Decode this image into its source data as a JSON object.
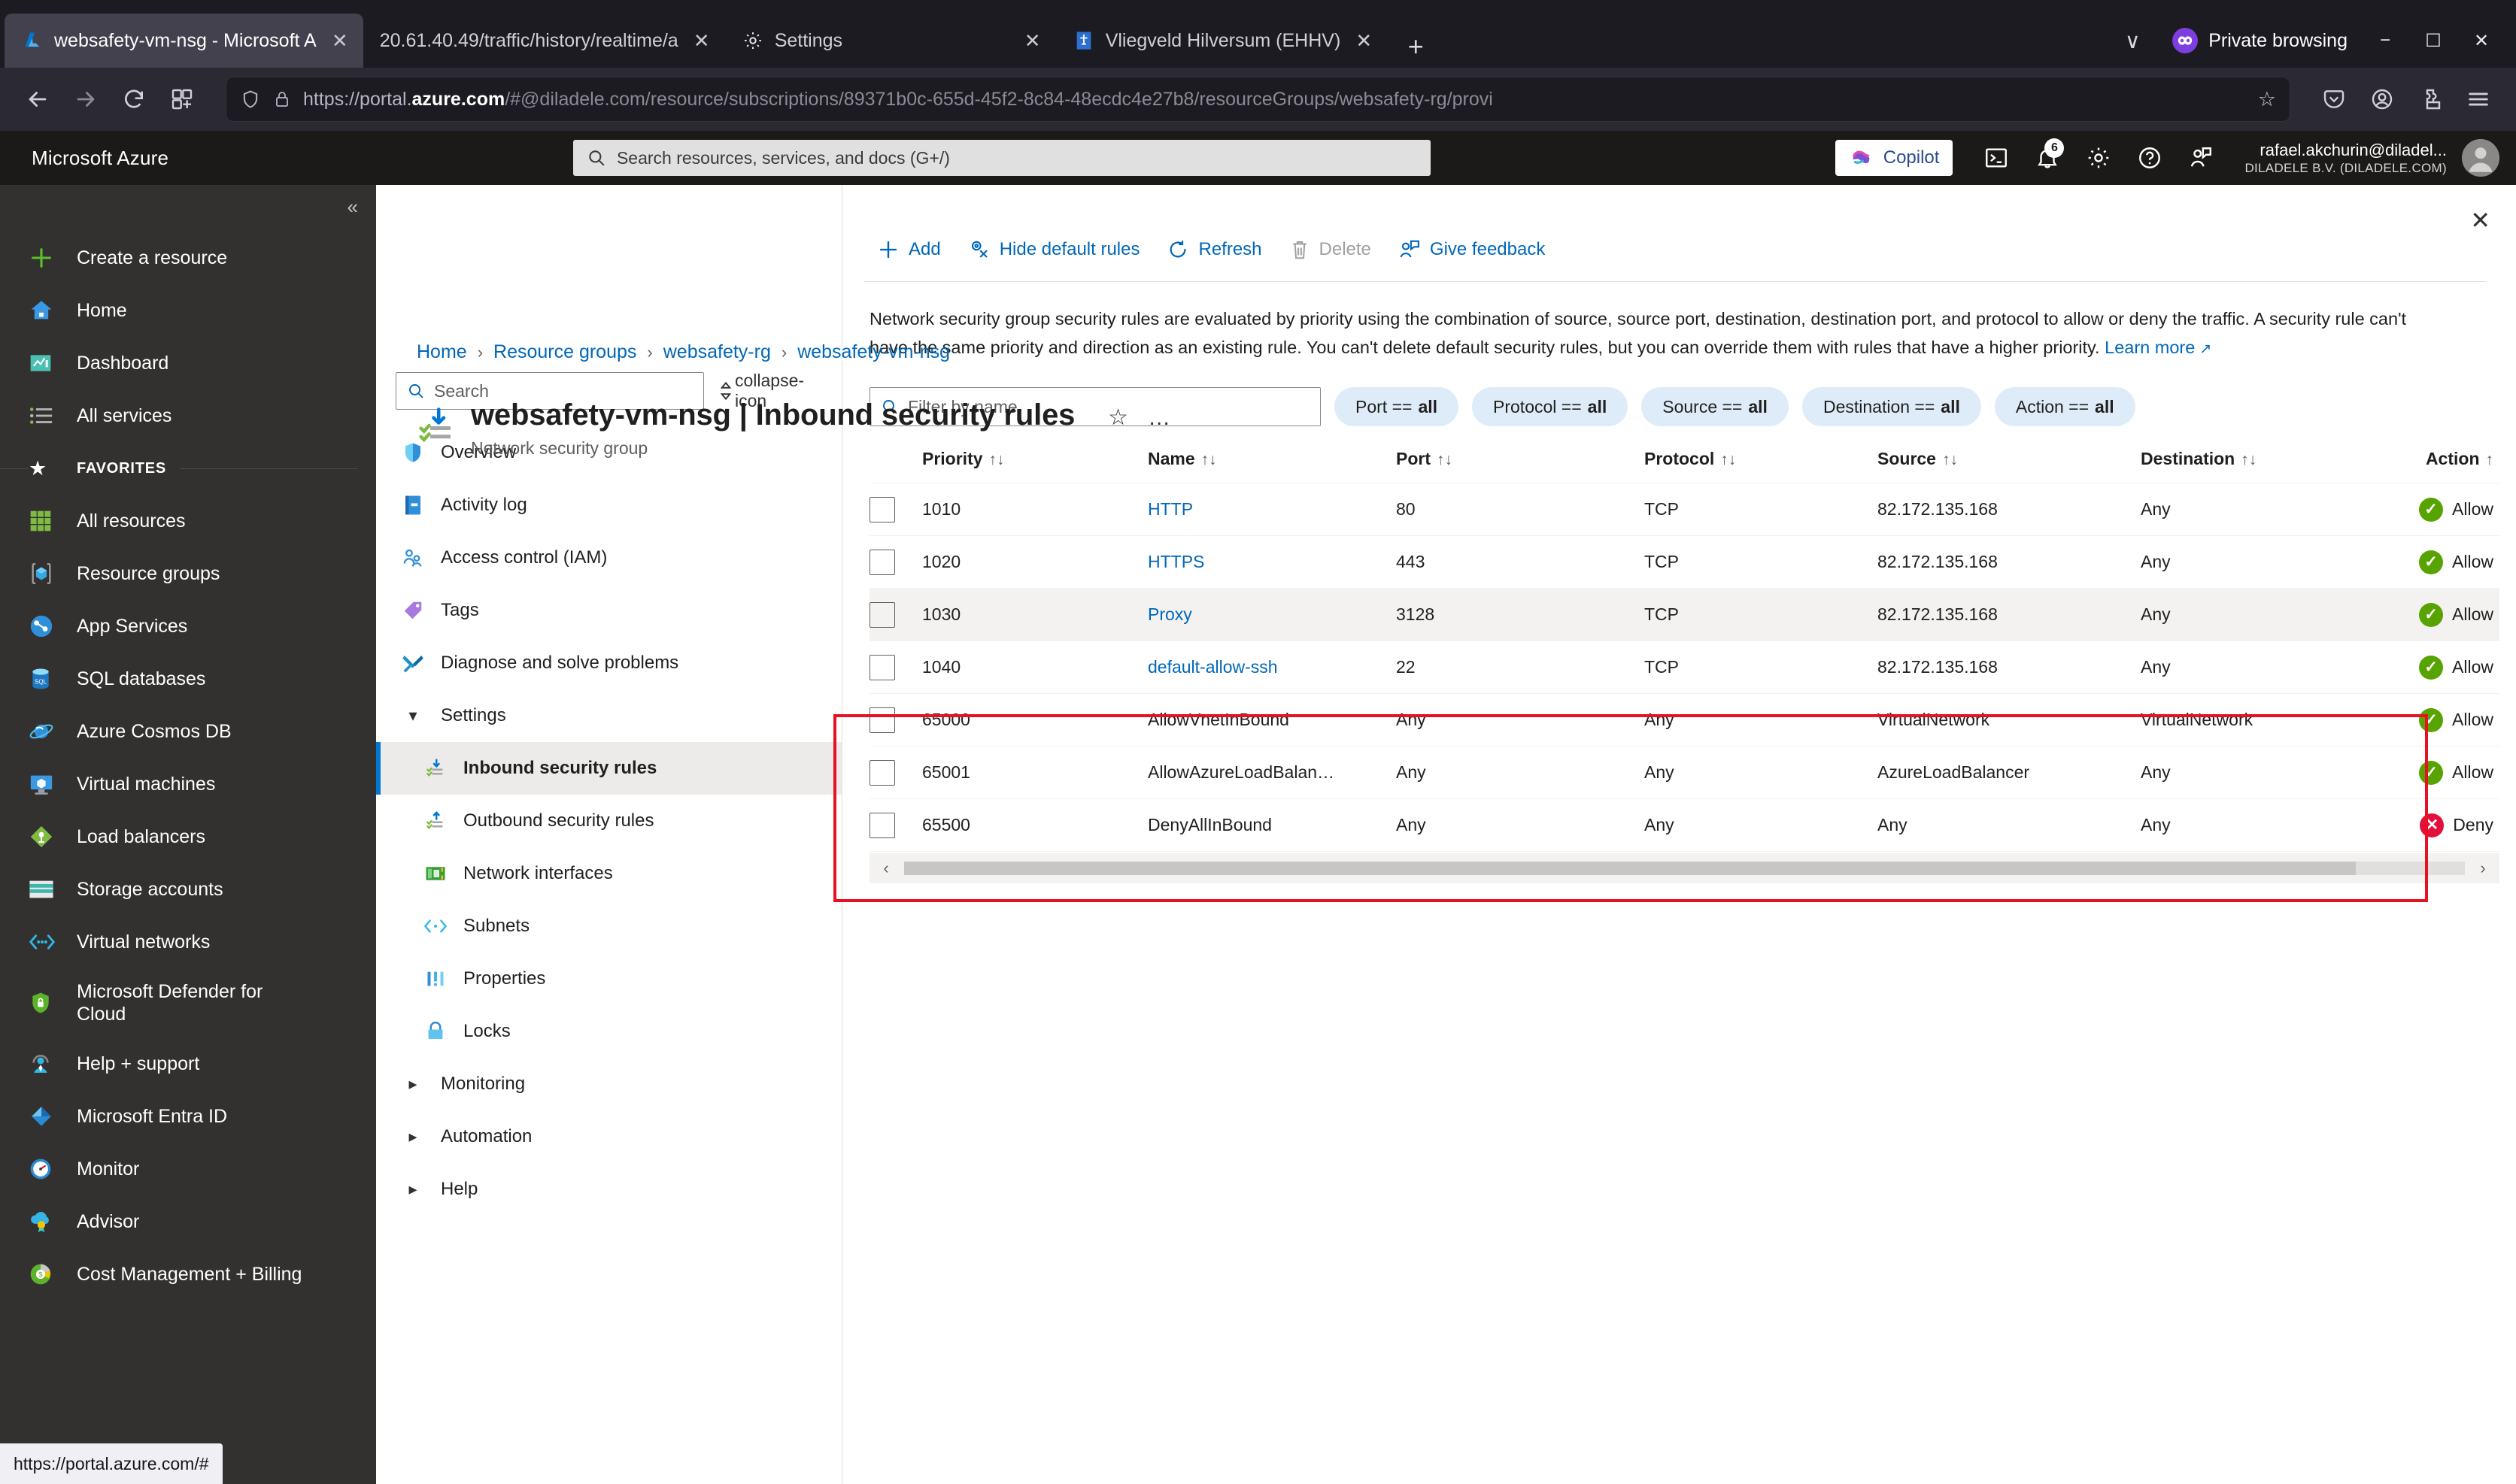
{
  "browser": {
    "tabs": [
      {
        "title": "websafety-vm-nsg - Microsoft A",
        "favicon": "azure-logo-icon",
        "active": true
      },
      {
        "title": "20.61.40.49/traffic/history/realtime/a",
        "favicon": "none",
        "active": false
      },
      {
        "title": "Settings",
        "favicon": "gear-icon",
        "active": false
      },
      {
        "title": "Vliegveld Hilversum (EHHV)",
        "favicon": "site-icon",
        "active": false
      }
    ],
    "new_tab_label": "+",
    "list_all_tabs_label": "∨",
    "private_browsing_label": "Private browsing",
    "window_minimize": "−",
    "window_maximize": "☐",
    "window_close": "✕",
    "url_prefix": "https://portal.",
    "url_domain": "azure.com",
    "url_path": "/#@diladele.com/resource/subscriptions/89371b0c-655d-45f2-8c84-48ecdc4e27b8/resourceGroups/websafety-rg/provi",
    "back_label": "←",
    "forward_label": "→",
    "reload_label": "↻"
  },
  "status_bar": {
    "url": "https://portal.azure.com/#"
  },
  "azure_header": {
    "brand": "Microsoft Azure",
    "search_placeholder": "Search resources, services, and docs (G+/)",
    "copilot_label": "Copilot",
    "notifications_count": "6",
    "account_email": "rafael.akchurin@diladel...",
    "account_org": "DILADELE B.V. (DILADELE.COM)"
  },
  "left_nav": {
    "collapse_label": "«",
    "top_items": [
      {
        "label": "Create a resource",
        "icon": "plus-icon"
      },
      {
        "label": "Home",
        "icon": "home-icon"
      },
      {
        "label": "Dashboard",
        "icon": "dashboard-icon"
      },
      {
        "label": "All services",
        "icon": "all-services-icon"
      }
    ],
    "favorites_label": "FAVORITES",
    "favorites": [
      {
        "label": "All resources",
        "icon": "all-resources-icon"
      },
      {
        "label": "Resource groups",
        "icon": "resource-groups-icon"
      },
      {
        "label": "App Services",
        "icon": "app-services-icon"
      },
      {
        "label": "SQL databases",
        "icon": "sql-databases-icon"
      },
      {
        "label": "Azure Cosmos DB",
        "icon": "cosmos-db-icon"
      },
      {
        "label": "Virtual machines",
        "icon": "virtual-machines-icon"
      },
      {
        "label": "Load balancers",
        "icon": "load-balancers-icon"
      },
      {
        "label": "Storage accounts",
        "icon": "storage-accounts-icon"
      },
      {
        "label": "Virtual networks",
        "icon": "virtual-networks-icon"
      },
      {
        "label": "Microsoft Defender for Cloud",
        "icon": "defender-icon"
      },
      {
        "label": "Help + support",
        "icon": "help-support-icon"
      },
      {
        "label": "Microsoft Entra ID",
        "icon": "entra-id-icon"
      },
      {
        "label": "Monitor",
        "icon": "monitor-icon"
      },
      {
        "label": "Advisor",
        "icon": "advisor-icon"
      },
      {
        "label": "Cost Management + Billing",
        "icon": "cost-management-icon"
      }
    ]
  },
  "breadcrumb": [
    {
      "label": "Home"
    },
    {
      "label": "Resource groups"
    },
    {
      "label": "websafety-rg"
    },
    {
      "label": "websafety-vm-nsg"
    }
  ],
  "blade": {
    "title": "websafety-vm-nsg | Inbound security rules",
    "subtitle": "Network security group",
    "favorite_icon": "star-icon",
    "more_icon": "ellipsis-icon",
    "close_icon": "close-icon",
    "menu_search_placeholder": "Search",
    "menu_sort_icon": "sort-icon",
    "menu_collapse_icon": "collapse-icon"
  },
  "resource_menu": {
    "items": [
      {
        "label": "Overview",
        "icon": "shield-icon",
        "type": "item",
        "selected": false
      },
      {
        "label": "Activity log",
        "icon": "activity-log-icon",
        "type": "item",
        "selected": false
      },
      {
        "label": "Access control (IAM)",
        "icon": "access-control-icon",
        "type": "item",
        "selected": false
      },
      {
        "label": "Tags",
        "icon": "tags-icon",
        "type": "item",
        "selected": false
      },
      {
        "label": "Diagnose and solve problems",
        "icon": "diagnose-icon",
        "type": "item",
        "selected": false
      },
      {
        "label": "Settings",
        "icon": "chevron-down-icon",
        "type": "group-open"
      },
      {
        "label": "Inbound security rules",
        "icon": "inbound-rules-icon",
        "type": "sub",
        "selected": true
      },
      {
        "label": "Outbound security rules",
        "icon": "outbound-rules-icon",
        "type": "sub",
        "selected": false
      },
      {
        "label": "Network interfaces",
        "icon": "network-interfaces-icon",
        "type": "sub",
        "selected": false
      },
      {
        "label": "Subnets",
        "icon": "subnets-icon",
        "type": "sub",
        "selected": false
      },
      {
        "label": "Properties",
        "icon": "properties-icon",
        "type": "sub",
        "selected": false
      },
      {
        "label": "Locks",
        "icon": "locks-icon",
        "type": "sub",
        "selected": false
      },
      {
        "label": "Monitoring",
        "icon": "chevron-right-icon",
        "type": "group-closed"
      },
      {
        "label": "Automation",
        "icon": "chevron-right-icon",
        "type": "group-closed"
      },
      {
        "label": "Help",
        "icon": "chevron-right-icon",
        "type": "group-closed"
      }
    ]
  },
  "toolbar": {
    "commands": [
      {
        "label": "Add",
        "icon": "plus-icon",
        "disabled": false
      },
      {
        "label": "Hide default rules",
        "icon": "hide-rules-icon",
        "disabled": false
      },
      {
        "label": "Refresh",
        "icon": "refresh-icon",
        "disabled": false
      },
      {
        "label": "Delete",
        "icon": "trash-icon",
        "disabled": true
      },
      {
        "label": "Give feedback",
        "icon": "feedback-icon",
        "disabled": false
      }
    ]
  },
  "description": {
    "text": "Network security group security rules are evaluated by priority using the combination of source, source port, destination, destination port, and protocol to allow or deny the traffic. A security rule can't have the same priority and direction as an existing rule. You can't delete default security rules, but you can override them with rules that have a higher priority. ",
    "link_label": "Learn more",
    "link_icon": "external-link-icon"
  },
  "filters": {
    "name_placeholder": "Filter by name",
    "pills": [
      {
        "field": "Port ==",
        "value": "all"
      },
      {
        "field": "Protocol ==",
        "value": "all"
      },
      {
        "field": "Source ==",
        "value": "all"
      },
      {
        "field": "Destination ==",
        "value": "all"
      },
      {
        "field": "Action ==",
        "value": "all"
      }
    ]
  },
  "table": {
    "columns": [
      "Priority",
      "Name",
      "Port",
      "Protocol",
      "Source",
      "Destination",
      "Action"
    ],
    "sort_glyph": "↑↓",
    "action_sort_glyph": "↑",
    "rows": [
      {
        "priority": "1010",
        "name": "HTTP",
        "name_link": true,
        "port": "80",
        "protocol": "TCP",
        "source": "82.172.135.168",
        "destination": "Any",
        "action": "Allow",
        "action_type": "allow",
        "alt": false
      },
      {
        "priority": "1020",
        "name": "HTTPS",
        "name_link": true,
        "port": "443",
        "protocol": "TCP",
        "source": "82.172.135.168",
        "destination": "Any",
        "action": "Allow",
        "action_type": "allow",
        "alt": false
      },
      {
        "priority": "1030",
        "name": "Proxy",
        "name_link": true,
        "port": "3128",
        "protocol": "TCP",
        "source": "82.172.135.168",
        "destination": "Any",
        "action": "Allow",
        "action_type": "allow",
        "alt": true
      },
      {
        "priority": "1040",
        "name": "default-allow-ssh",
        "name_link": true,
        "port": "22",
        "protocol": "TCP",
        "source": "82.172.135.168",
        "destination": "Any",
        "action": "Allow",
        "action_type": "allow",
        "alt": false
      },
      {
        "priority": "65000",
        "name": "AllowVnetInBound",
        "name_link": false,
        "port": "Any",
        "protocol": "Any",
        "source": "VirtualNetwork",
        "destination": "VirtualNetwork",
        "action": "Allow",
        "action_type": "allow",
        "alt": false
      },
      {
        "priority": "65001",
        "name": "AllowAzureLoadBalan…",
        "name_link": false,
        "port": "Any",
        "protocol": "Any",
        "source": "AzureLoadBalancer",
        "destination": "Any",
        "action": "Allow",
        "action_type": "allow",
        "alt": false
      },
      {
        "priority": "65500",
        "name": "DenyAllInBound",
        "name_link": false,
        "port": "Any",
        "protocol": "Any",
        "source": "Any",
        "destination": "Any",
        "action": "Deny",
        "action_type": "deny",
        "alt": false
      }
    ],
    "scroll_left_icon": "‹",
    "scroll_right_icon": "›"
  },
  "highlight": {
    "color": "#e81123",
    "rows": [
      0,
      1,
      2,
      3
    ]
  }
}
